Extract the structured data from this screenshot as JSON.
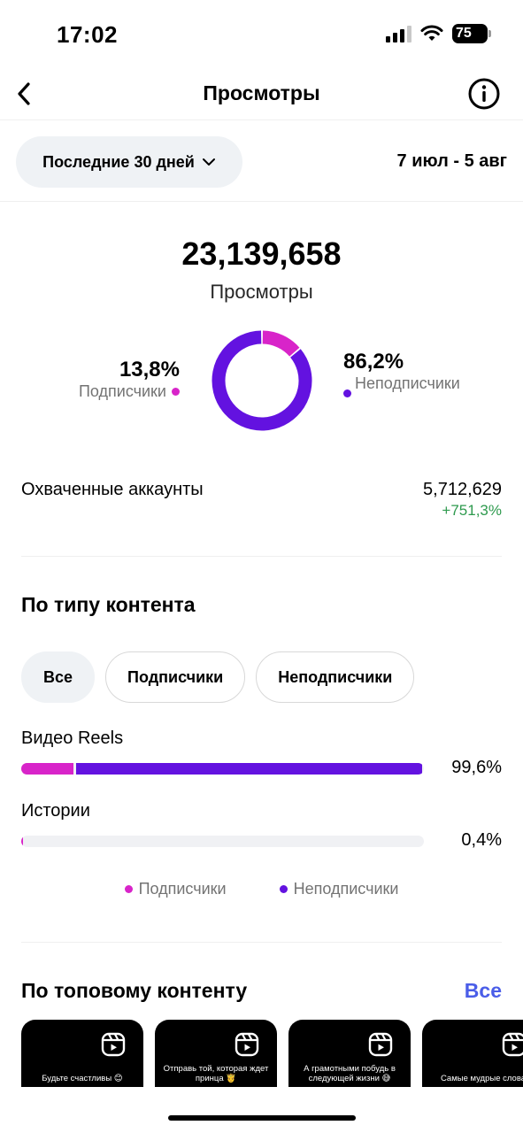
{
  "status_bar": {
    "time": "17:02",
    "battery": "75"
  },
  "nav": {
    "title": "Просмотры",
    "back_icon": "chevron-left-icon",
    "info_icon": "info-circle-icon"
  },
  "filter": {
    "period": "Последние 30 дней",
    "date_range": "7 июл - 5 авг"
  },
  "summary": {
    "total": "23,139,658",
    "label": "Просмотры"
  },
  "audience": {
    "followers": {
      "percent": "13,8%",
      "label": "Подписчики",
      "value": 13.8,
      "color": "#d824c9"
    },
    "non_followers": {
      "percent": "86,2%",
      "label": "Неподписчики",
      "value": 86.2,
      "color": "#6312e0"
    }
  },
  "reach": {
    "label": "Охваченные аккаунты",
    "value": "5,712,629",
    "delta": "+751,3%",
    "delta_color": "#2e9a4e"
  },
  "content_type": {
    "title": "По типу контента",
    "chips": [
      "Все",
      "Подписчики",
      "Неподписчики"
    ],
    "active_chip": "Все",
    "rows": [
      {
        "label": "Видео Reels",
        "value": "99,6%",
        "total": 99.6,
        "followers_share": 13.0
      },
      {
        "label": "Истории",
        "value": "0,4%",
        "total": 0.4,
        "followers_share": 0.4
      }
    ],
    "legend": [
      "Подписчики",
      "Неподписчики"
    ]
  },
  "top_content": {
    "title": "По топовому контенту",
    "see_all": "Все",
    "link_color": "#4a5de8",
    "items": [
      {
        "caption": "Будьте счастливы 😊"
      },
      {
        "caption": "Отправь той, которая ждет принца 🤴"
      },
      {
        "caption": "А грамотными побудь в следующей жизни 😅"
      },
      {
        "caption": "Самые мудрые слова"
      }
    ]
  }
}
